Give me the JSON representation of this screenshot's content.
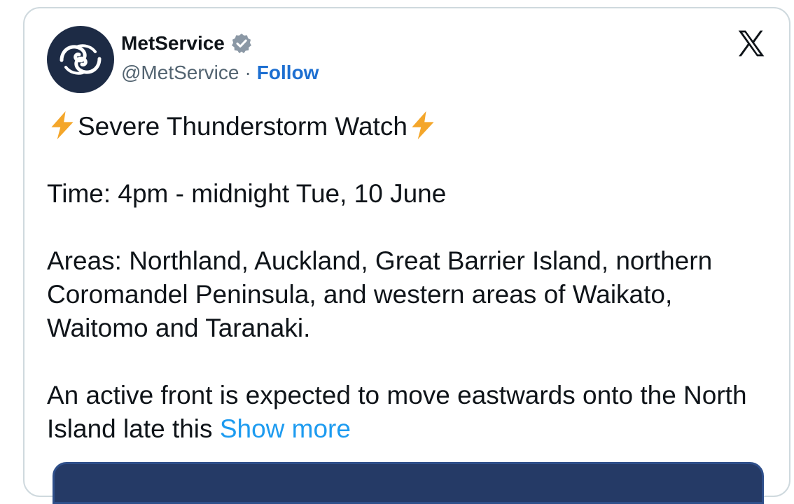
{
  "author": {
    "display_name": "MetService",
    "handle": "@MetService",
    "separator": "·",
    "follow_label": "Follow"
  },
  "tweet": {
    "title": "Severe Thunderstorm Watch",
    "time_line": "Time: 4pm - midnight Tue, 10 June",
    "areas_line": "Areas: Northland, Auckland, Great Barrier Island, northern Coromandel Peninsula, and western areas of Waikato, Waitomo and Taranaki.",
    "summary_line": "An active front is expected to move eastwards onto the North Island late this",
    "show_more_label": "Show more"
  },
  "icons": {
    "avatar": "metservice-logo",
    "verified": "verified-badge-icon",
    "platform": "x-logo-icon",
    "emoji": "lightning-bolt-emoji"
  },
  "colors": {
    "link": "#1d9bf0",
    "follow": "#1d6fd1",
    "avatar_bg": "#1d2b45",
    "text": "#0f1419",
    "secondary_text": "#536471",
    "border": "#cfd9de",
    "bolt": "#f4a62a"
  }
}
